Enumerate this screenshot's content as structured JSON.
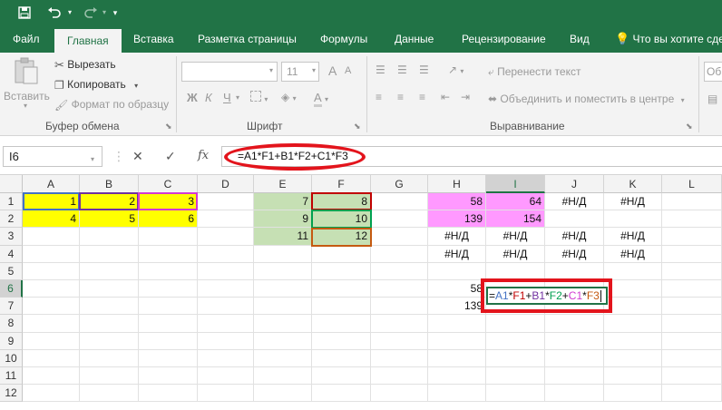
{
  "qat": {
    "save_icon": "save-icon",
    "undo_icon": "undo-icon",
    "redo_icon": "redo-icon",
    "customize_icon": "customize-qat-icon"
  },
  "tabs": [
    "Файл",
    "Главная",
    "Вставка",
    "Разметка страницы",
    "Формулы",
    "Данные",
    "Рецензирование",
    "Вид",
    "Что вы хотите сде"
  ],
  "active_tab": "Главная",
  "ribbon": {
    "clipboard": {
      "paste": "Вставить",
      "cut": "Вырезать",
      "copy": "Копировать",
      "format_painter": "Формат по образцу",
      "group": "Буфер обмена"
    },
    "font": {
      "font_name": "",
      "font_size": "11",
      "bold": "Ж",
      "italic": "К",
      "underline": "Ч",
      "grow": "A",
      "shrink": "A",
      "color": "A",
      "group": "Шрифт"
    },
    "alignment": {
      "wrap": "Перенести текст",
      "merge": "Объединить и поместить в центре",
      "group": "Выравнивание"
    },
    "number": {
      "format": "Общ"
    }
  },
  "formula_bar": {
    "name_box": "I6",
    "cancel": "✕",
    "enter": "✓",
    "fx": "fx",
    "formula": "=A1*F1+B1*F2+C1*F3"
  },
  "columns": [
    "A",
    "B",
    "C",
    "D",
    "E",
    "F",
    "G",
    "H",
    "I",
    "J",
    "K",
    "L"
  ],
  "rows": [
    "1",
    "2",
    "3",
    "4",
    "5",
    "6",
    "7",
    "8",
    "9",
    "10",
    "11",
    "12"
  ],
  "cells": {
    "A1": "1",
    "B1": "2",
    "C1": "3",
    "A2": "4",
    "B2": "5",
    "C2": "6",
    "E1": "7",
    "F1": "8",
    "E2": "9",
    "F2": "10",
    "E3": "11",
    "F3": "12",
    "H1": "58",
    "I1": "64",
    "J1": "#Н/Д",
    "K1": "#Н/Д",
    "H2": "139",
    "I2": "154",
    "H3": "#Н/Д",
    "I3": "#Н/Д",
    "J3": "#Н/Д",
    "K3": "#Н/Д",
    "H4": "#Н/Д",
    "I4": "#Н/Д",
    "J4": "#Н/Д",
    "K4": "#Н/Д",
    "H6": "58",
    "H7": "139"
  },
  "edit": {
    "parts": [
      "=",
      "A1",
      "*",
      "F1",
      "+",
      "B1",
      "*",
      "F2",
      "+",
      "C1",
      "*",
      "F3"
    ]
  },
  "colors": {
    "excel_green": "#217346",
    "highlight_red": "#e3141c",
    "yellow_fill": "#ffff00",
    "green_fill": "#c6e0b4",
    "pink_fill": "#ff99ff"
  }
}
